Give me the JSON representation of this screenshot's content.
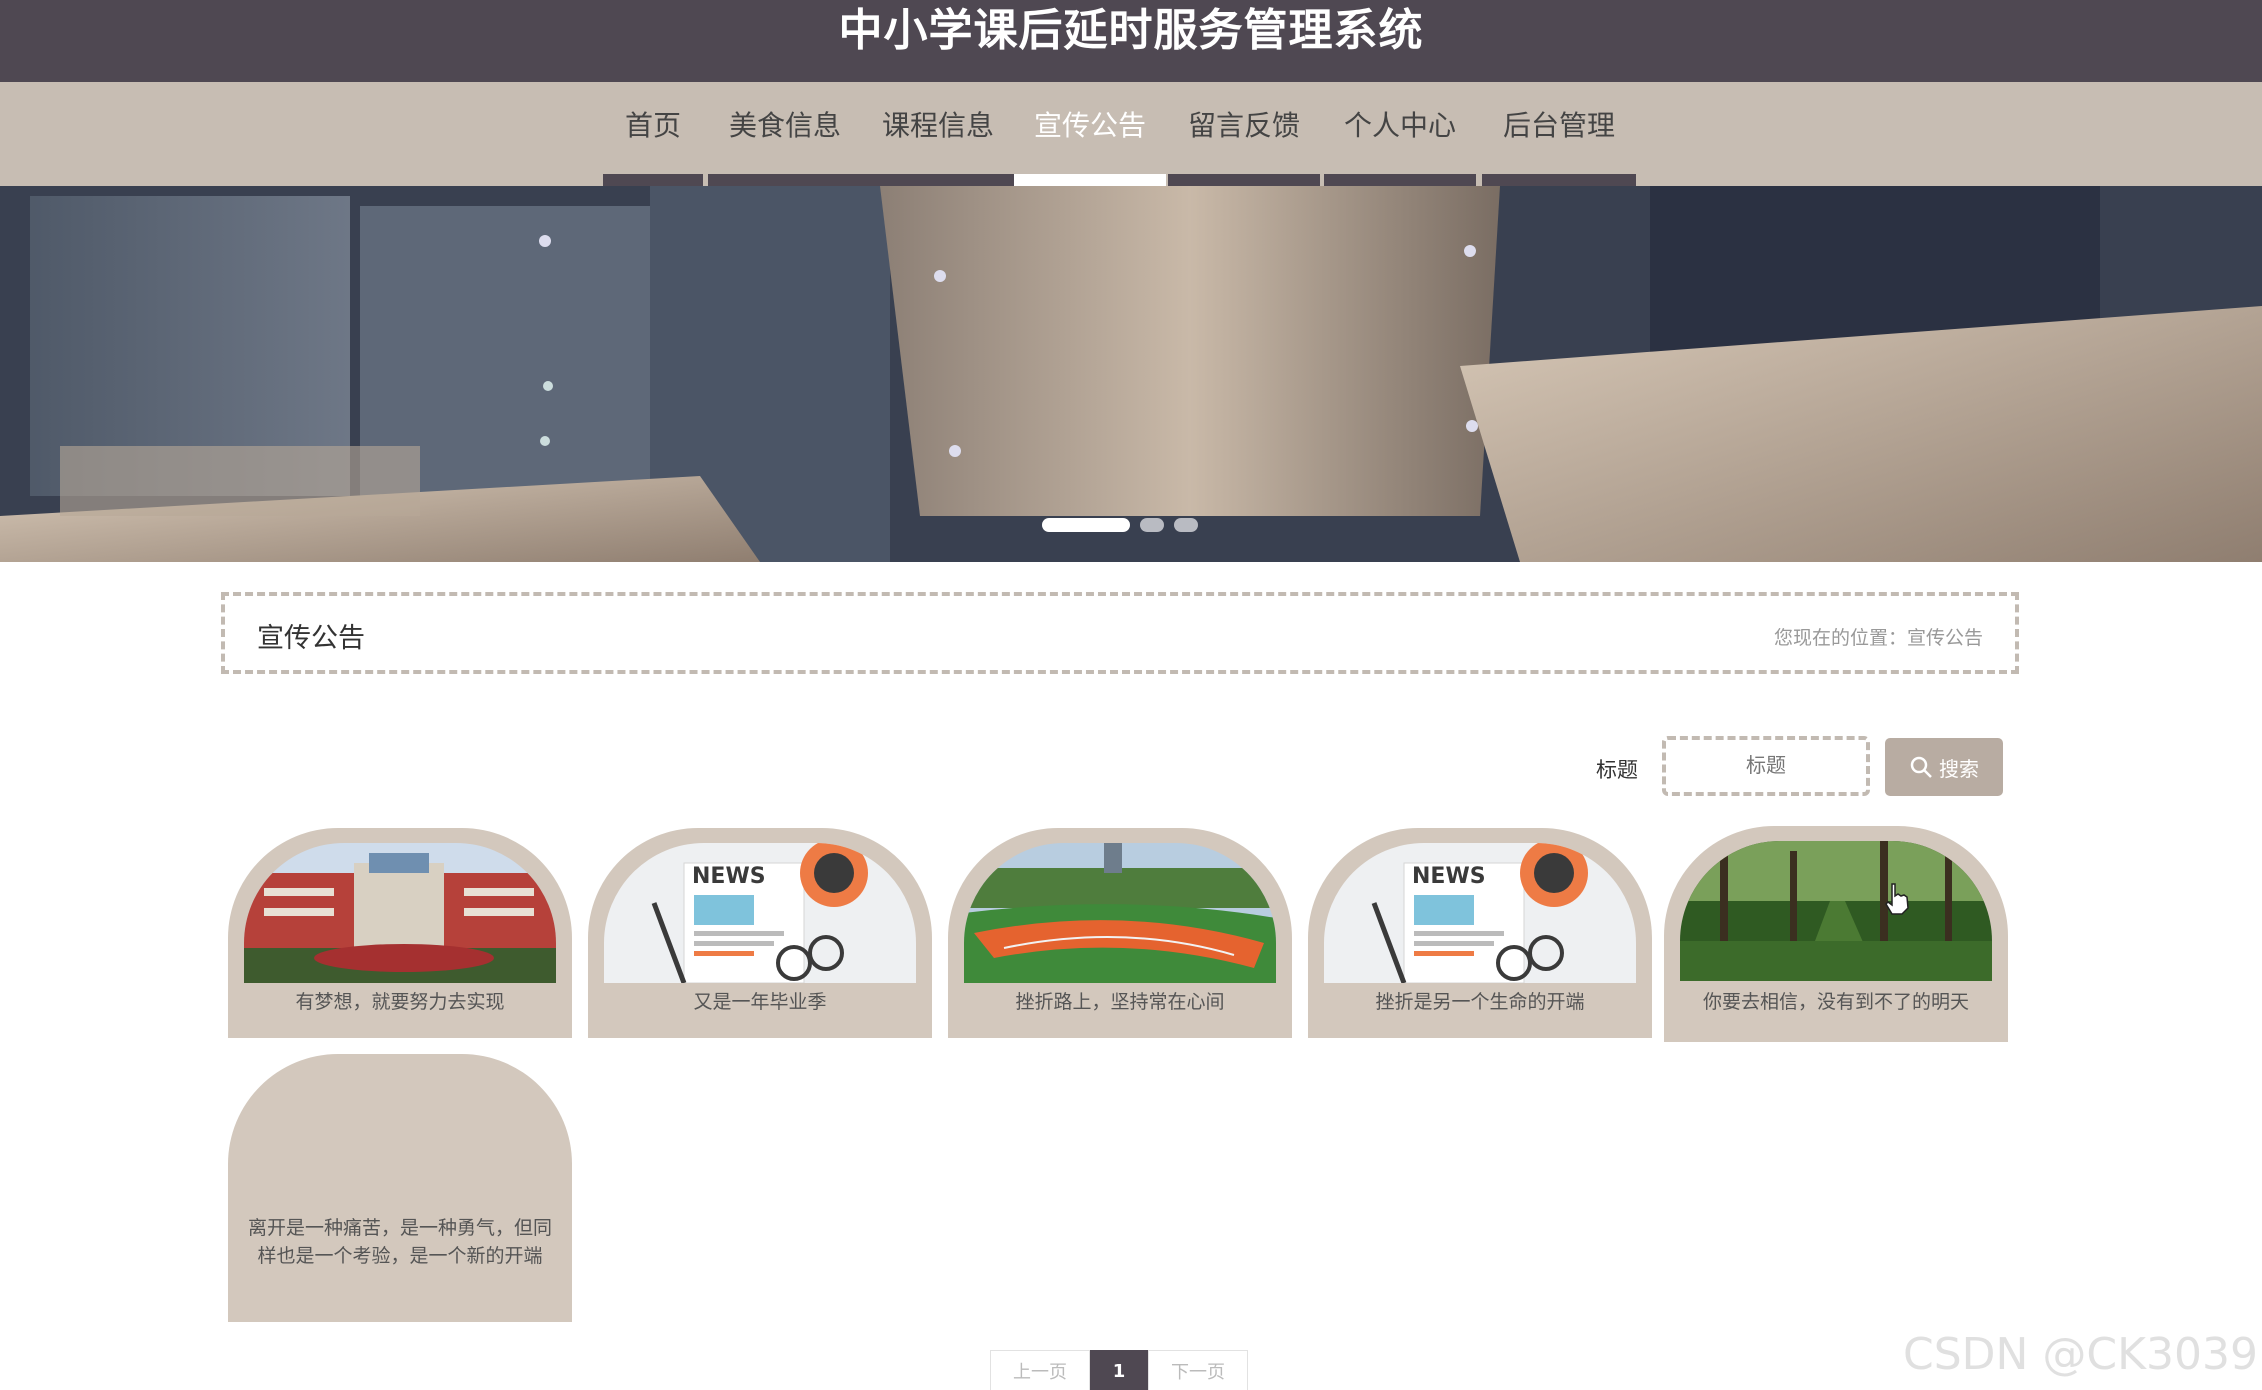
{
  "site": {
    "title": "中小学课后延时服务管理系统"
  },
  "nav": {
    "items": [
      {
        "label": "首页"
      },
      {
        "label": "美食信息"
      },
      {
        "label": "课程信息"
      },
      {
        "label": "宣传公告",
        "active": true
      },
      {
        "label": "留言反馈"
      },
      {
        "label": "个人中心"
      },
      {
        "label": "后台管理"
      }
    ]
  },
  "banner": {
    "slide_count": 3,
    "active_slide": 1
  },
  "breadcrumb": {
    "title": "宣传公告",
    "path": "您现在的位置：宣传公告"
  },
  "search": {
    "label": "标题",
    "placeholder": "标题",
    "button_label": "搜索",
    "button_icon": "search-icon"
  },
  "cards": [
    {
      "title": "有梦想，就要努力去实现",
      "image": "school-building"
    },
    {
      "title": "又是一年毕业季",
      "image": "news-illustration"
    },
    {
      "title": "挫折路上，坚持常在心间",
      "image": "running-track"
    },
    {
      "title": "挫折是另一个生命的开端",
      "image": "news-illustration"
    },
    {
      "title": "你要去相信，没有到不了的明天",
      "image": "tree-path"
    },
    {
      "title": "离开是一种痛苦，是一种勇气，但同样也是一个考验，是一个新的开端",
      "image": ""
    }
  ],
  "pagination": {
    "prev": "上一页",
    "current": "1",
    "next": "下一页"
  },
  "colors": {
    "header_bg": "#4f4852",
    "nav_bg": "#c7bdb3",
    "card_bg": "#d3c8bd",
    "accent": "#b8aca2"
  },
  "watermark": "CSDN @CK3039"
}
